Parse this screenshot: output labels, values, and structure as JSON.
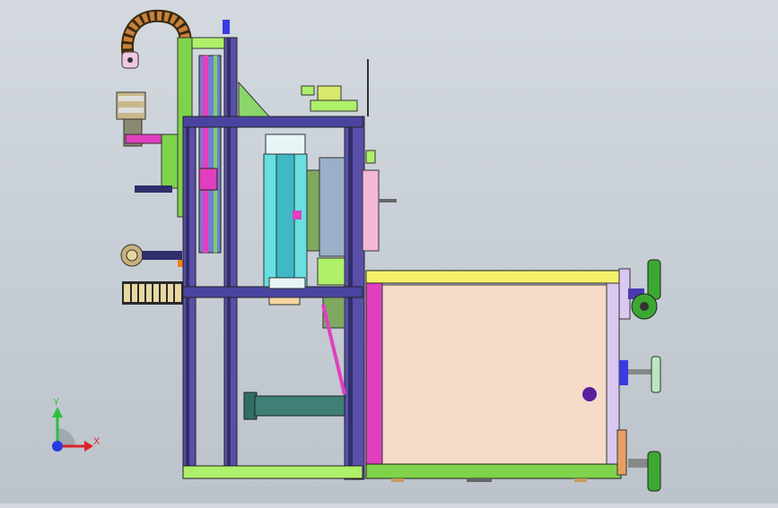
{
  "viewport": {
    "background_top": "#d3d9df",
    "background_bottom": "#bcc3ca"
  },
  "triad": {
    "x_label": "X",
    "y_label": "Y",
    "x_color": "#e0202a",
    "y_color": "#2fbf3f",
    "z_color": "#2a3ae0"
  },
  "colors": {
    "frame_dark": "#2f2f6b",
    "frame_purple": "#5a4fa8",
    "cyan": "#66e0e0",
    "magenta": "#e03fbf",
    "pink_panel": "#f2b8d6",
    "green": "#7fd34a",
    "lime": "#aef06a",
    "yellow": "#f5f06a",
    "beige": "#f6dcc8",
    "cable_orange": "#c9813a",
    "wheel_green": "#3ca832",
    "teal_tube": "#3f7f75"
  }
}
